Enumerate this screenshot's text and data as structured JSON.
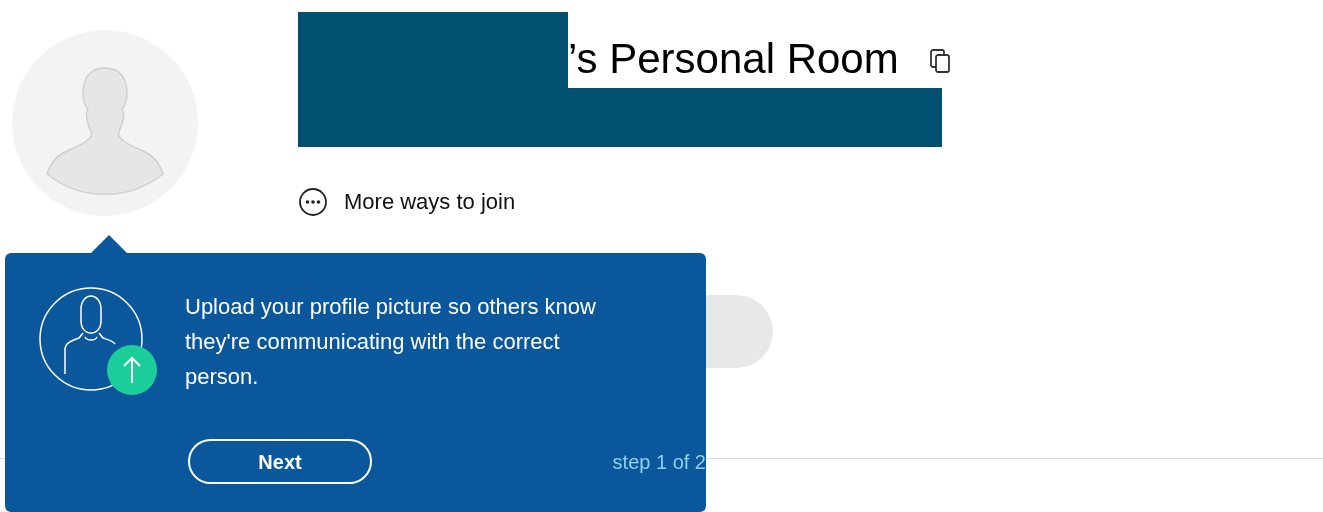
{
  "room": {
    "title": "’s Personal Room"
  },
  "join": {
    "label": "More ways to join"
  },
  "tour": {
    "message": "Upload your profile picture so others know they're communicating with the correct person.",
    "button": "Next",
    "step": "step 1 of 2"
  }
}
